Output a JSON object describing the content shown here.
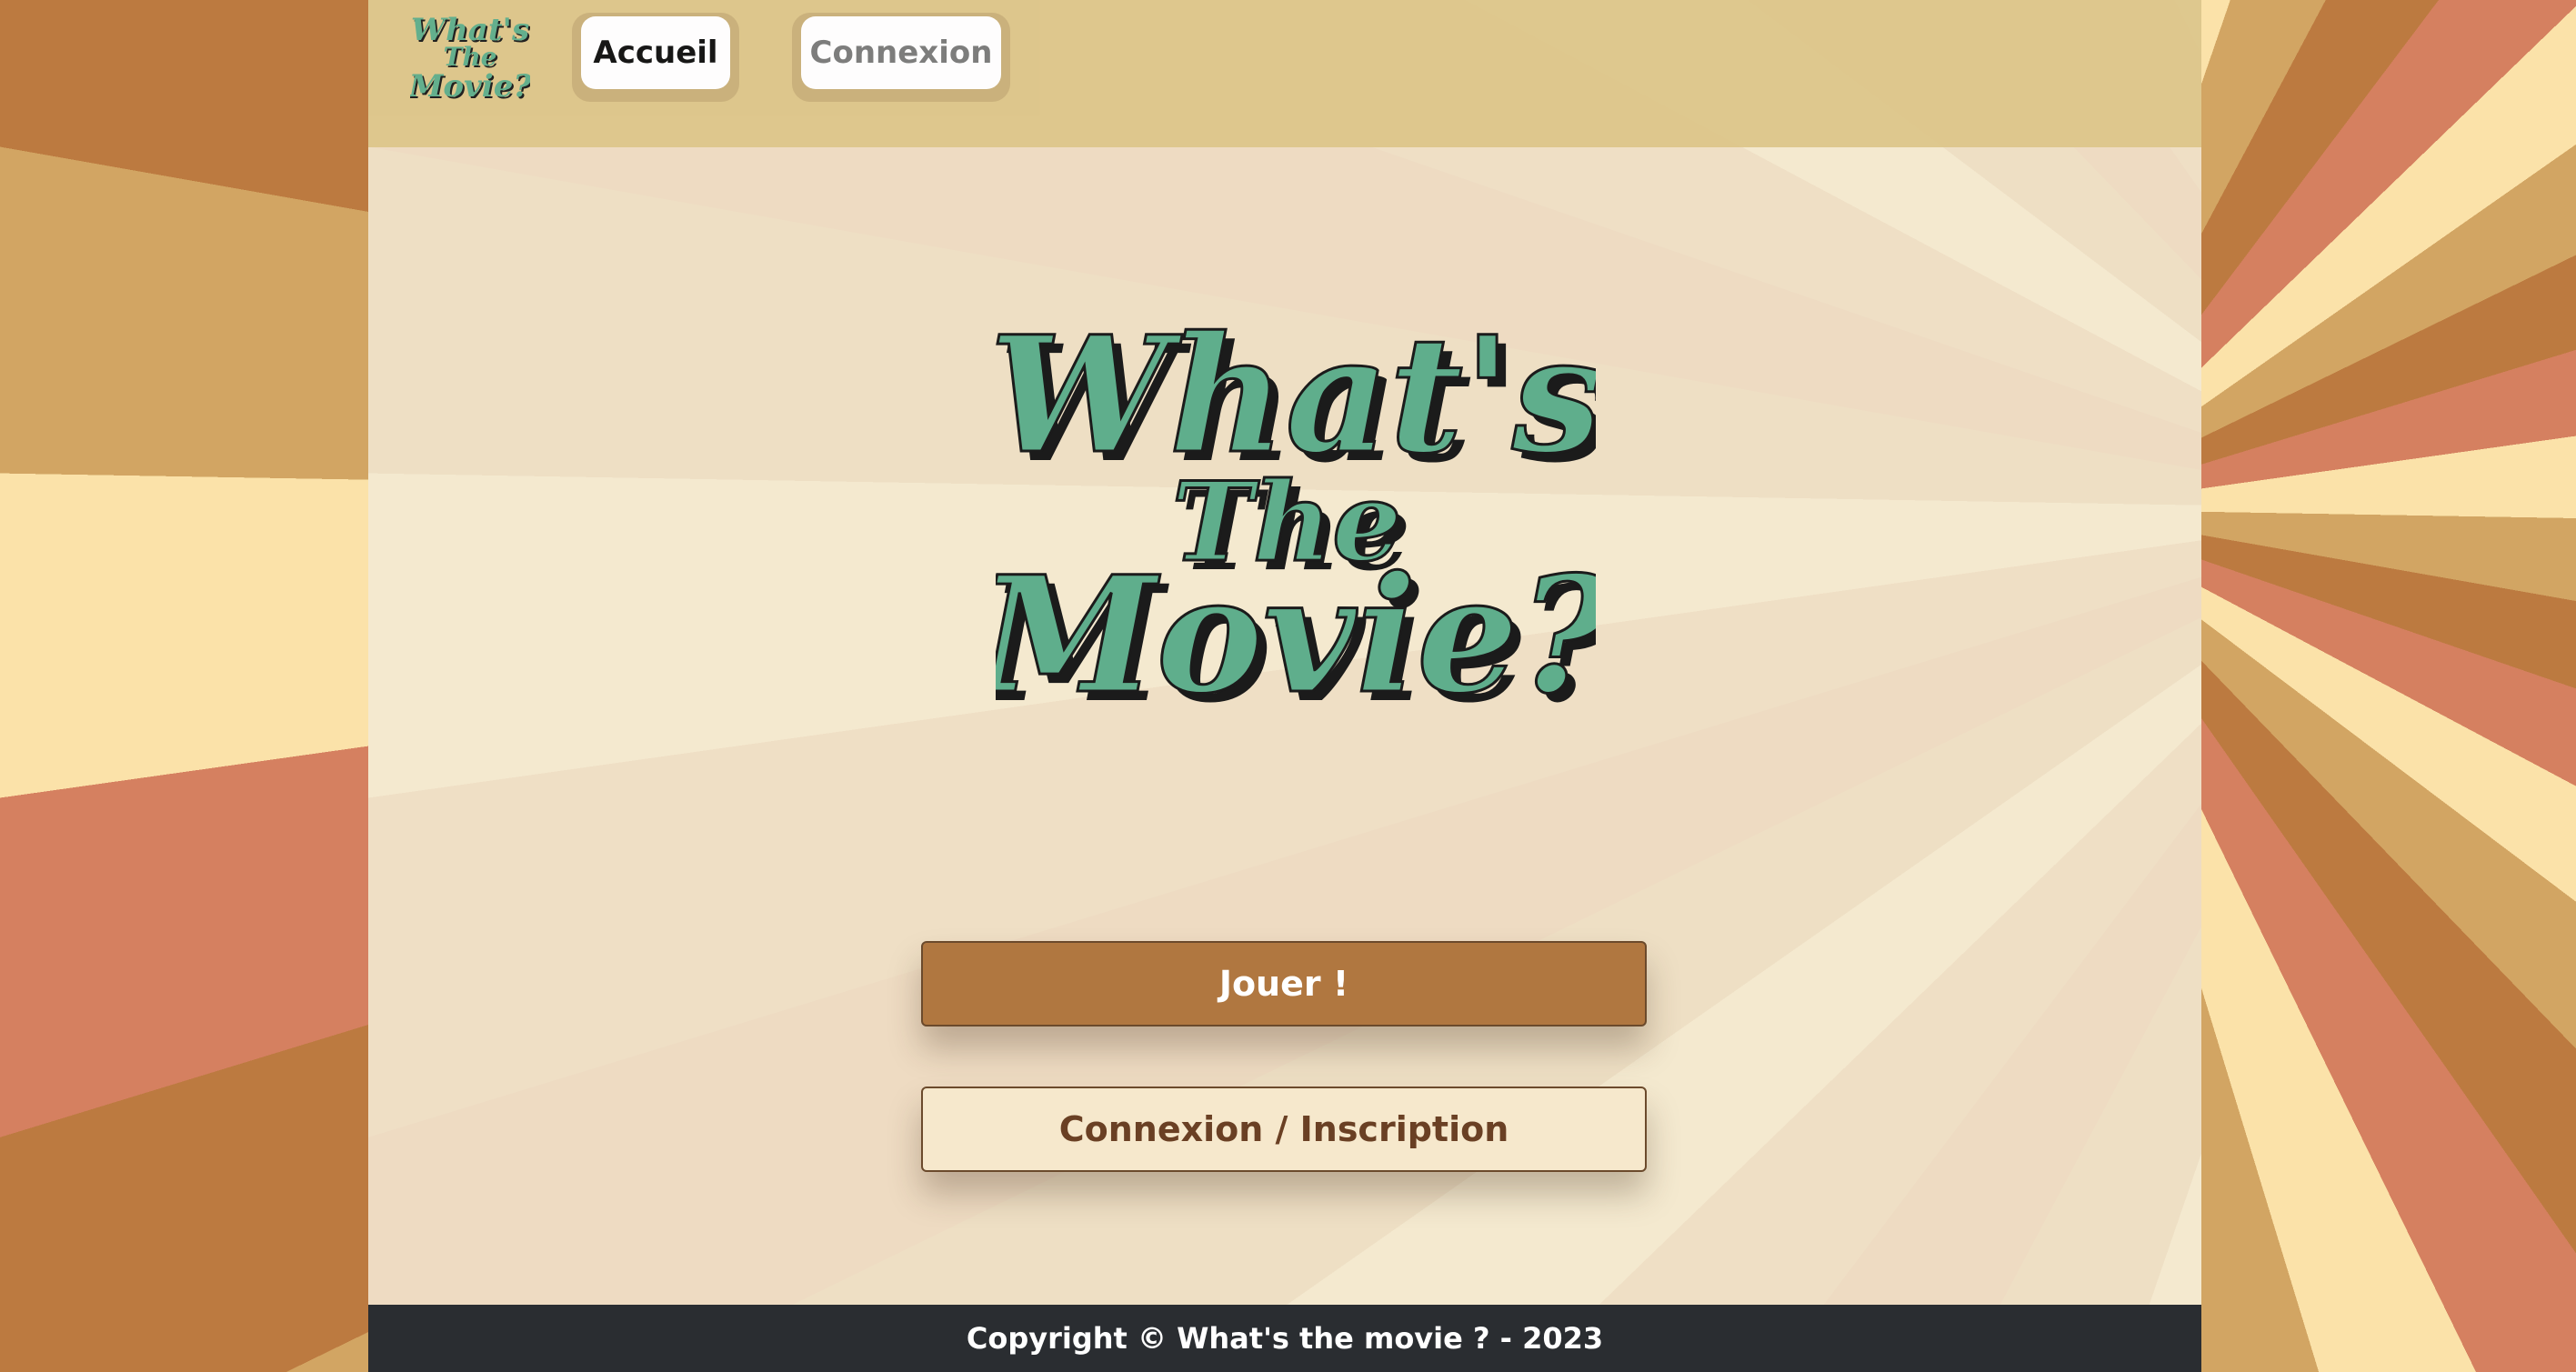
{
  "app": {
    "logo_text": [
      "What's",
      "The",
      "Movie?"
    ]
  },
  "nav": {
    "home_label": "Accueil",
    "login_label": "Connexion"
  },
  "hero": {
    "logo_lines": [
      "What's",
      "The",
      "Movie?"
    ]
  },
  "actions": {
    "play_label": "Jouer !",
    "login_signup_label": "Connexion / Inscription"
  },
  "footer": {
    "copyright": "Copyright © What's the movie ? - 2023"
  },
  "colors": {
    "header_bg": "#ddc68b",
    "logo_green": "#5fae8c",
    "play_button_bg": "#b07740",
    "login_button_bg": "#f6e8cc",
    "footer_bg": "#2a2d31",
    "swirl_cream": "#fbe2a9",
    "swirl_tan": "#d2a563",
    "swirl_brown": "#bc7a40",
    "swirl_coral": "#d58060"
  }
}
